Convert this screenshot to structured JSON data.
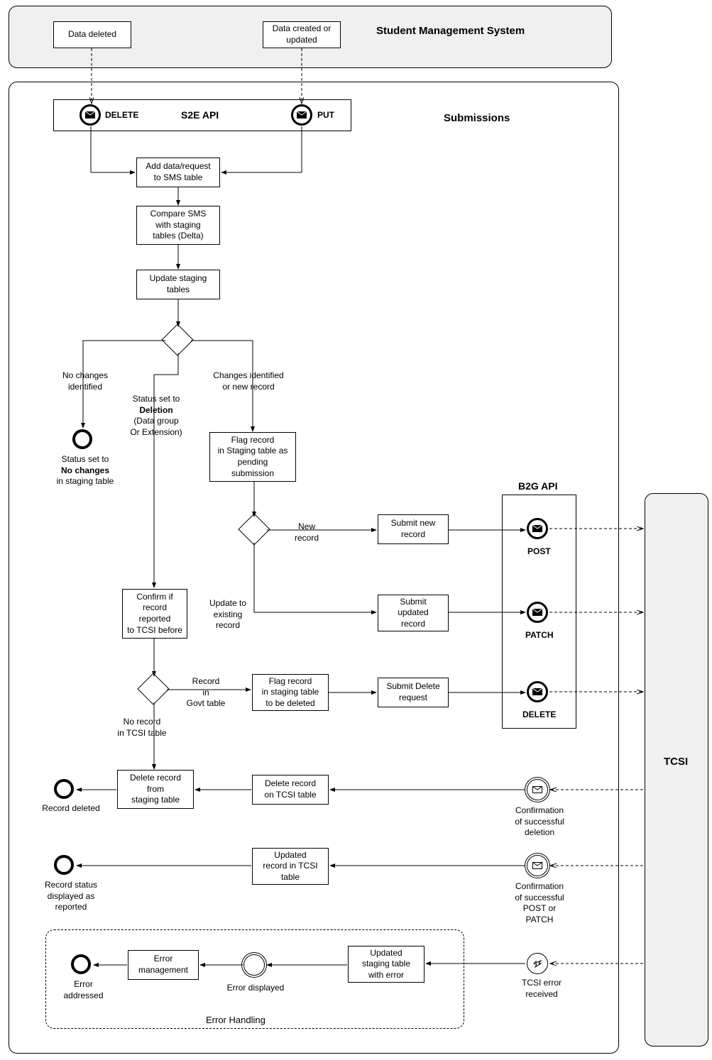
{
  "pools": {
    "sms": {
      "title": "Student Management System"
    },
    "submissions": {
      "title": "Submissions"
    },
    "tcsi": {
      "title": "TCSI"
    }
  },
  "sms_boxes": {
    "deleted": "Data deleted",
    "created": "Data created or\nupdated"
  },
  "s2e": {
    "title": "S2E API",
    "delete": "DELETE",
    "put": "PUT"
  },
  "b2g": {
    "title": "B2G API",
    "post": "POST",
    "patch": "PATCH",
    "delete": "DELETE"
  },
  "tasks": {
    "add_data": "Add data/request\nto SMS table",
    "compare": "Compare SMS\nwith staging\ntables (Delta)",
    "update_staging": "Update staging\ntables",
    "flag_pending": "Flag record\nin Staging table as\npending\nsubmission",
    "submit_new": "Submit new\nrecord",
    "submit_updated": "Submit\nupdated\nrecord",
    "confirm_reported": "Confirm if\nrecord\nreported\nto TCSI before",
    "flag_delete": "Flag record\nin staging table\nto be deleted",
    "submit_delete": "Submit Delete\nrequest",
    "delete_tcsi_table": "Delete record\non TCSI table",
    "delete_staging": "Delete record\nfrom\nstaging table",
    "updated_tcsi": "Updated\nrecord in TCSI\ntable",
    "updated_staging_err": "Updated\nstaging table\nwith error",
    "error_mgmt": "Error\nmanagement"
  },
  "edge_labels": {
    "no_changes": "No changes\nidentified",
    "changes": "Changes identified\nor new record",
    "deletion": "Status set to\nDeletion\n(Data group\nOr Extension)",
    "new_record": "New\nrecord",
    "update_existing": "Update to\nexisting\nrecord",
    "record_in_govt": "Record\nin\nGovt table",
    "no_record_tcsi": "No record\nin TCSI table"
  },
  "end_labels": {
    "no_changes": "Status set to\nNo changes\nin staging table",
    "record_deleted": "Record deleted",
    "record_reported": "Record status\ndisplayed as\nreported",
    "error_addressed": "Error\naddressed",
    "error_displayed": "Error displayed"
  },
  "confirmations": {
    "deletion": "Confirmation\nof successful\ndeletion",
    "post_patch": "Confirmation\nof successful\nPOST or\nPATCH",
    "error": "TCSI error\nreceived"
  },
  "error_handling": {
    "title": "Error Handling"
  }
}
